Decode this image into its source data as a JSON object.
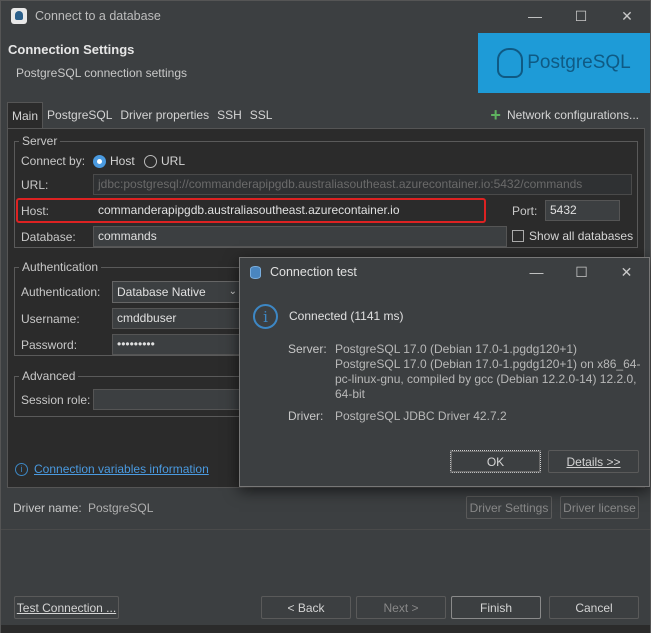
{
  "window": {
    "title": "Connect to a database",
    "minimize": "—",
    "maximize": "☐",
    "close": "✕"
  },
  "header": {
    "title": "Connection Settings",
    "subtitle": "PostgreSQL connection settings",
    "logo_text": "PostgreSQL"
  },
  "tabs": [
    "Main",
    "PostgreSQL",
    "Driver properties",
    "SSH",
    "SSL"
  ],
  "network_config": "Network configurations...",
  "server": {
    "legend": "Server",
    "connect_by_label": "Connect by:",
    "host_radio": "Host",
    "url_radio": "URL",
    "connect_by_selected": "Host",
    "url_label": "URL:",
    "url_value": "jdbc:postgresql://commanderapipgdb.australiasoutheast.azurecontainer.io:5432/commands",
    "host_label": "Host:",
    "host_value": "commanderapipgdb.australiasoutheast.azurecontainer.io",
    "port_label": "Port:",
    "port_value": "5432",
    "database_label": "Database:",
    "database_value": "commands",
    "show_all_label": "Show all databases",
    "show_all_checked": false
  },
  "auth": {
    "legend": "Authentication",
    "auth_label": "Authentication:",
    "auth_value": "Database Native",
    "username_label": "Username:",
    "username_value": "cmddbuser",
    "password_label": "Password:",
    "password_value": "•••••••••"
  },
  "advanced": {
    "legend": "Advanced",
    "session_role_label": "Session role:",
    "session_role_value": ""
  },
  "conn_vars_link": "Connection variables information",
  "driver": {
    "label": "Driver name:",
    "value": "PostgreSQL",
    "settings_btn": "Driver Settings",
    "license_btn": "Driver license"
  },
  "footer": {
    "test_btn": "Test Connection ...",
    "back_btn": "< Back",
    "next_btn": "Next >",
    "finish_btn": "Finish",
    "cancel_btn": "Cancel"
  },
  "dialog": {
    "title": "Connection test",
    "status": "Connected (1141 ms)",
    "server_label": "Server:",
    "server_line1": "PostgreSQL 17.0 (Debian 17.0-1.pgdg120+1)",
    "server_line2": "PostgreSQL 17.0 (Debian 17.0-1.pgdg120+1) on x86_64-",
    "server_line3": "pc-linux-gnu, compiled by gcc (Debian 12.2.0-14) 12.2.0,",
    "server_line4": "64-bit",
    "driver_label": "Driver:",
    "driver_value": "PostgreSQL JDBC Driver 42.7.2",
    "ok_btn": "OK",
    "details_btn": "Details >>"
  },
  "colors": {
    "accent": "#4a9ae0",
    "highlight": "#dd2222",
    "logo_bg": "#1e9bd7"
  }
}
